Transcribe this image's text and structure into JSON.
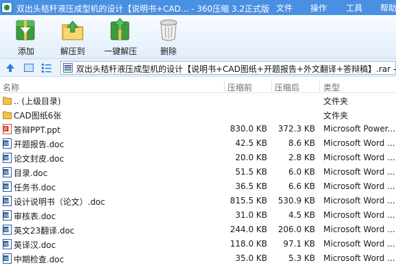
{
  "window": {
    "title": "双出头秸秆液压成型机的设计【说明书+CAD... - 360压缩 3.2正式版",
    "menu": [
      "文件",
      "操作",
      "工具",
      "帮助"
    ]
  },
  "toolbar": {
    "add_label": "添加",
    "extract_to_label": "解压到",
    "one_click_extract_label": "一键解压",
    "delete_label": "删除"
  },
  "address": {
    "path": "双出头秸秆液压成型机的设计【说明书+CAD图纸+开题报告+外文翻译+答辩稿】.rar - "
  },
  "columns": {
    "name": "名称",
    "size": "压缩前",
    "packed": "压缩后",
    "type": "类型"
  },
  "files": [
    {
      "icon": "folder-up-icon",
      "name": ".. (上级目录)",
      "size": "",
      "packed": "",
      "type": "文件夹"
    },
    {
      "icon": "folder-icon",
      "name": "CAD图纸6张",
      "size": "",
      "packed": "",
      "type": "文件夹"
    },
    {
      "icon": "ppt-file-icon",
      "name": "答辩PPT.ppt",
      "size": "830.0 KB",
      "packed": "372.3 KB",
      "type": "Microsoft Power..."
    },
    {
      "icon": "word-file-icon",
      "name": "开题报告.doc",
      "size": "42.5 KB",
      "packed": "8.6 KB",
      "type": "Microsoft Word ..."
    },
    {
      "icon": "word-file-icon",
      "name": "论文封皮.doc",
      "size": "20.0 KB",
      "packed": "2.8 KB",
      "type": "Microsoft Word ..."
    },
    {
      "icon": "word-file-icon",
      "name": "目录.doc",
      "size": "51.5 KB",
      "packed": "6.0 KB",
      "type": "Microsoft Word ..."
    },
    {
      "icon": "word-file-icon",
      "name": "任务书.doc",
      "size": "36.5 KB",
      "packed": "6.6 KB",
      "type": "Microsoft Word ..."
    },
    {
      "icon": "word-file-icon",
      "name": "设计说明书（论文）.doc",
      "size": "815.5 KB",
      "packed": "530.9 KB",
      "type": "Microsoft Word ..."
    },
    {
      "icon": "word-file-icon",
      "name": "审核表.doc",
      "size": "31.0 KB",
      "packed": "4.5 KB",
      "type": "Microsoft Word ..."
    },
    {
      "icon": "word-file-icon",
      "name": "英文23翻译.doc",
      "size": "244.0 KB",
      "packed": "206.0 KB",
      "type": "Microsoft Word ..."
    },
    {
      "icon": "word-file-icon",
      "name": "英译汉.doc",
      "size": "118.0 KB",
      "packed": "97.1 KB",
      "type": "Microsoft Word ..."
    },
    {
      "icon": "word-file-icon",
      "name": "中期检查.doc",
      "size": "35.0 KB",
      "packed": "5.3 KB",
      "type": "Microsoft Word ..."
    }
  ]
}
